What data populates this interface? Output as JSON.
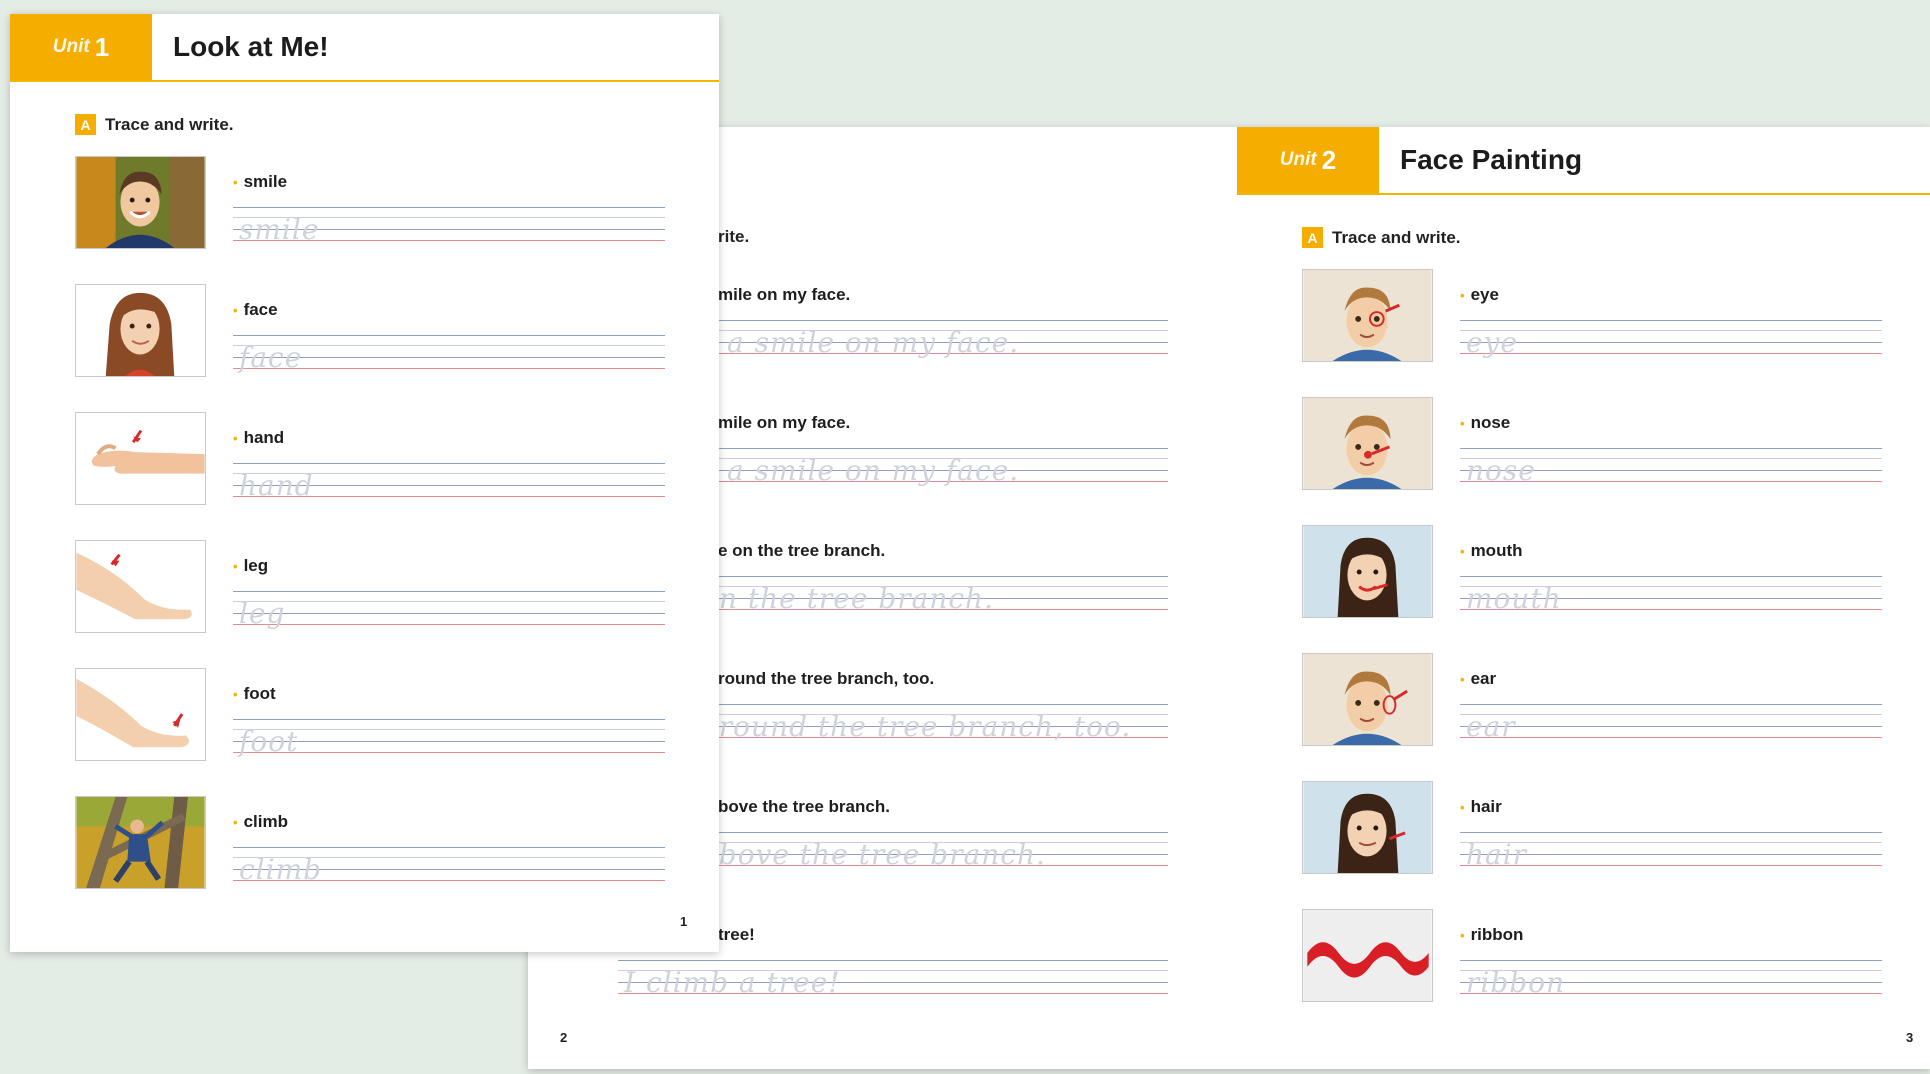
{
  "back_spread": {
    "left_page": {
      "instruction_visible": "rite.",
      "sentences": [
        {
          "text": "mile on my face.",
          "trace": "I have a smile on my face."
        },
        {
          "text": "mile on my face.",
          "trace": "I have a smile on my face."
        },
        {
          "text": "e on the tree branch.",
          "trace": "I am on the tree branch."
        },
        {
          "text": "round the tree branch, too.",
          "trace": "I am around the tree branch, too."
        },
        {
          "text": "bove the tree branch.",
          "trace": "I am above the tree branch."
        },
        {
          "text": "tree!",
          "trace": "I climb a tree!"
        }
      ],
      "page_number": "2"
    },
    "right_page": {
      "unit_word": "Unit",
      "unit_number": "2",
      "title": "Face Painting",
      "instruction_badge": "A",
      "instruction": "Trace and write.",
      "items": [
        {
          "word": "eye",
          "trace": "eye",
          "icon": "boy-face-painted-eye"
        },
        {
          "word": "nose",
          "trace": "nose",
          "icon": "boy-face-painted-nose"
        },
        {
          "word": "mouth",
          "trace": "mouth",
          "icon": "girl-face-painted-mouth"
        },
        {
          "word": "ear",
          "trace": "ear",
          "icon": "boy-face-painted-ear"
        },
        {
          "word": "hair",
          "trace": "hair",
          "icon": "girl-face-painted-hair"
        },
        {
          "word": "ribbon",
          "trace": "ribbon",
          "icon": "red-ribbon"
        }
      ],
      "page_number": "3"
    }
  },
  "front_page": {
    "unit_word": "Unit",
    "unit_number": "1",
    "title": "Look at Me!",
    "instruction_badge": "A",
    "instruction": "Trace and write.",
    "items": [
      {
        "word": "smile",
        "trace": "smile",
        "icon": "smiling-boy-photo"
      },
      {
        "word": "face",
        "trace": "face",
        "icon": "girl-face-photo"
      },
      {
        "word": "hand",
        "trace": "hand",
        "icon": "hand-photo"
      },
      {
        "word": "leg",
        "trace": "leg",
        "icon": "leg-photo"
      },
      {
        "word": "foot",
        "trace": "foot",
        "icon": "foot-photo"
      },
      {
        "word": "climb",
        "trace": "climb",
        "icon": "boy-climbing-tree-photo"
      }
    ],
    "page_number": "1"
  },
  "colors": {
    "accent": "#f5ad00",
    "background": "#e4ece6",
    "guide_blue": "#8f9fbf",
    "guide_red": "#e48b92",
    "marker_red": "#d82828"
  }
}
